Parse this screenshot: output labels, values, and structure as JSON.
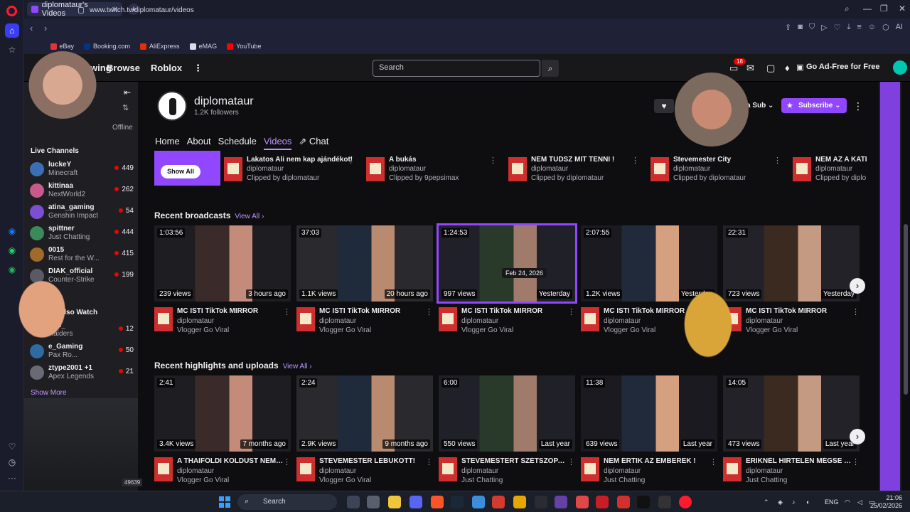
{
  "browser": {
    "tab_title": "diplomataur's Videos",
    "url": "www.twitch.tv/diplomataur/videos",
    "bookmarks": [
      "eBay",
      "Booking.com",
      "AliExpress",
      "eMAG",
      "YouTube"
    ]
  },
  "twitch_nav": {
    "following": "Following",
    "browse": "Browse",
    "roblox": "Roblox",
    "search_placeholder": "Search",
    "notif_count": "18",
    "adfree": "Go Ad-Free for Free"
  },
  "sidebar": {
    "offline": "Offline",
    "live_channels_header": "Live Channels",
    "live_channels": [
      {
        "name": "luckeY",
        "game": "Minecraft",
        "viewers": "449",
        "color": "#3b6fb5"
      },
      {
        "name": "kittinaa",
        "game": "NextWorld2",
        "viewers": "262",
        "color": "#c75a8a"
      },
      {
        "name": "atina_gaming",
        "game": "Genshin Impact",
        "viewers": "54",
        "color": "#7c4fd1"
      },
      {
        "name": "spittner",
        "game": "Just Chatting",
        "viewers": "444",
        "color": "#3a8a5c"
      },
      {
        "name": "0015",
        "game": "Rest for the W...",
        "viewers": "415",
        "color": "#a06a2b"
      },
      {
        "name": "DIAK_official",
        "game": "Counter-Strike",
        "viewers": "199",
        "color": "#5a5a66"
      }
    ],
    "also_watch_header": "Viewers Also Watch",
    "also_watch": [
      {
        "name": "Rcs_",
        "game": "Raiders",
        "viewers": "12",
        "color": "#8a3a3a"
      },
      {
        "name": "e_Gaming",
        "game": "Pax Ro...",
        "viewers": "50",
        "color": "#2f6aa0"
      },
      {
        "name": "ztype2001 +1",
        "game": "Apex Legends",
        "viewers": "21",
        "color": "#6a6a76"
      }
    ],
    "show_more": "Show More"
  },
  "channel": {
    "name": "diplomataur",
    "followers": "1.2K followers",
    "gift_sub": "Gift a Sub",
    "subscribe": "Subscribe",
    "tabs": [
      "Home",
      "About",
      "Schedule",
      "Videos",
      "Chat"
    ],
    "active_tab": "Videos"
  },
  "clips": {
    "show_all": "Show All",
    "items": [
      {
        "title": "Lakatos Ali nem kap ajándékot!",
        "channel": "diplomataur",
        "by": "Clipped by diplomataur"
      },
      {
        "title": "A bukás",
        "channel": "diplomataur",
        "by": "Clipped by 9pepsimax"
      },
      {
        "title": "NEM TUDSZ MIT TENNI !",
        "channel": "diplomataur",
        "by": "Clipped by diplomataur"
      },
      {
        "title": "Stevemester City",
        "channel": "diplomataur",
        "by": "Clipped by diplomataur"
      },
      {
        "title": "NEM AZ A KATI",
        "channel": "diplomataur",
        "by": "Clipped by diplo"
      }
    ]
  },
  "broadcasts": {
    "header": "Recent broadcasts",
    "view_all": "View All",
    "tooltip": "Feb 24, 2026",
    "items": [
      {
        "duration": "1:03:56",
        "views": "239 views",
        "ago": "3 hours ago",
        "title": "MC ISTI TikTok MIRROR",
        "channel": "diplomataur",
        "game": "Vlogger Go Viral"
      },
      {
        "duration": "37:03",
        "views": "1.1K views",
        "ago": "20 hours ago",
        "title": "MC ISTI TikTok MIRROR",
        "channel": "diplomataur",
        "game": "Vlogger Go Viral"
      },
      {
        "duration": "1:24:53",
        "views": "997 views",
        "ago": "Yesterday",
        "title": "MC ISTI TikTok MIRROR",
        "channel": "diplomataur",
        "game": "Vlogger Go Viral"
      },
      {
        "duration": "2:07:55",
        "views": "1.2K views",
        "ago": "Yesterday",
        "title": "MC ISTI TikTok MIRROR",
        "channel": "diplomataur",
        "game": "Vlogger Go Viral"
      },
      {
        "duration": "22:31",
        "views": "723 views",
        "ago": "Yesterday",
        "title": "MC ISTI TikTok MIRROR",
        "channel": "diplomataur",
        "game": "Vlogger Go Viral"
      }
    ]
  },
  "highlights": {
    "header": "Recent highlights and uploads",
    "view_all": "View All",
    "items": [
      {
        "duration": "2:41",
        "views": "3.4K views",
        "ago": "7 months ago",
        "title": "A THAIFÖLDI KOLDUST NEM ...",
        "channel": "diplomataur",
        "game": "Vlogger Go Viral"
      },
      {
        "duration": "2:24",
        "views": "2.9K views",
        "ago": "9 months ago",
        "title": "STEVEMESTER LEBUKOTT!",
        "channel": "diplomataur",
        "game": "Vlogger Go Viral"
      },
      {
        "duration": "6:00",
        "views": "550 views",
        "ago": "Last year",
        "title": "STEVEMESTERT SZÉTSZOPAT...",
        "channel": "diplomataur",
        "game": "Just Chatting"
      },
      {
        "duration": "11:38",
        "views": "639 views",
        "ago": "Last year",
        "title": "NEM ÉRTIK AZ EMBEREK !",
        "channel": "diplomataur",
        "game": "Just Chatting"
      },
      {
        "duration": "14:05",
        "views": "473 views",
        "ago": "Last year",
        "title": "ERIKNÉL HIRTELEN MÉGSE TÉ...",
        "channel": "diplomataur",
        "game": "Just Chatting"
      }
    ]
  },
  "taskbar": {
    "search": "Search",
    "lang": "ENG",
    "time": "21:06",
    "date": "25/02/2026"
  },
  "overlay_counter": "49639"
}
